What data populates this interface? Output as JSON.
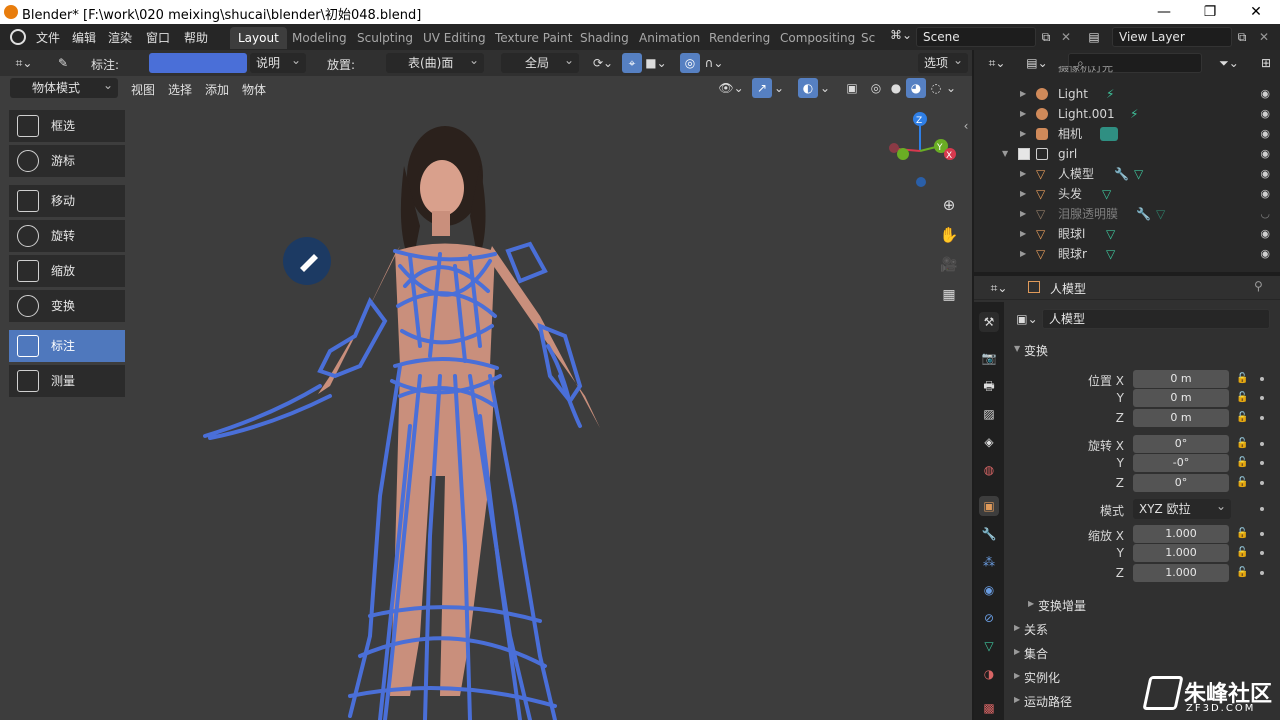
{
  "window": {
    "title": "Blender* [F:\\work\\020 meixing\\shucai\\blender\\初始048.blend]",
    "minimize": "—",
    "maximize": "❐",
    "close": "✕"
  },
  "topmenu": [
    "文件",
    "编辑",
    "渲染",
    "窗口",
    "帮助"
  ],
  "workspaces": [
    "Layout",
    "Modeling",
    "Sculpting",
    "UV Editing",
    "Texture Paint",
    "Shading",
    "Animation",
    "Rendering",
    "Compositing",
    "Sc"
  ],
  "active_workspace": "Layout",
  "scene": {
    "label": "Scene"
  },
  "view_layer": {
    "label": "View Layer"
  },
  "tool_header": {
    "annotate_label": "标注:",
    "annotate_color": "#4a6fd8",
    "layer_dropdown": "说明",
    "placement_label": "放置:",
    "placement_value": "表(曲)面",
    "global_value": "全局",
    "options_label": "选项"
  },
  "view_header": {
    "mode": "物体模式",
    "menus": [
      "视图",
      "选择",
      "添加",
      "物体"
    ]
  },
  "toolbar": [
    {
      "label": "框选",
      "active": false
    },
    {
      "label": "游标",
      "active": false
    },
    {
      "label": "移动",
      "active": false
    },
    {
      "label": "旋转",
      "active": false
    },
    {
      "label": "缩放",
      "active": false
    },
    {
      "label": "变换",
      "active": false
    },
    {
      "label": "标注",
      "active": true
    },
    {
      "label": "测量",
      "active": false
    }
  ],
  "gizmo": {
    "z": "Z",
    "y": "Y",
    "x": "X"
  },
  "outliner": {
    "partial_top": "摄像机灯光",
    "rows": [
      {
        "name": "Light",
        "kind": "light"
      },
      {
        "name": "Light.001",
        "kind": "light"
      },
      {
        "name": "相机",
        "kind": "camera"
      },
      {
        "name": "girl",
        "kind": "collection"
      },
      {
        "name": "人模型",
        "kind": "mesh"
      },
      {
        "name": "头发",
        "kind": "mesh"
      },
      {
        "name": "泪腺透明膜",
        "kind": "mesh-dim"
      },
      {
        "name": "眼球l",
        "kind": "mesh"
      },
      {
        "name": "眼球r",
        "kind": "mesh"
      }
    ]
  },
  "properties": {
    "header_object": "人模型",
    "object_name": "人模型",
    "transform_section": "变换",
    "location": {
      "label_x": "位置 X",
      "label_y": "Y",
      "label_z": "Z",
      "x": "0 m",
      "y": "0 m",
      "z": "0 m"
    },
    "rotation": {
      "label_x": "旋转 X",
      "label_y": "Y",
      "label_z": "Z",
      "x": "0°",
      "y": "-0°",
      "z": "0°"
    },
    "mode_label": "模式",
    "mode_value": "XYZ 欧拉",
    "scale": {
      "label_x": "缩放 X",
      "label_y": "Y",
      "label_z": "Z",
      "x": "1.000",
      "y": "1.000",
      "z": "1.000"
    },
    "delta_transform": "变换增量",
    "sections": [
      "关系",
      "集合",
      "实例化",
      "运动路径"
    ]
  },
  "watermark": {
    "brand": "朱峰社区",
    "url": "ZF3D.COM"
  }
}
